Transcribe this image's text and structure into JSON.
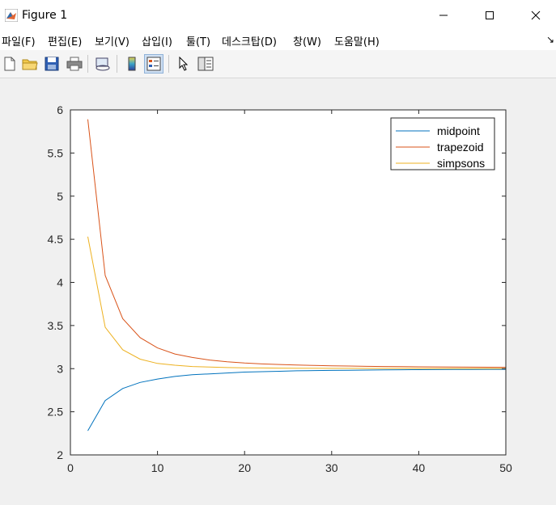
{
  "window": {
    "title": "Figure 1"
  },
  "menu": {
    "items": [
      "파일(F)",
      "편집(E)",
      "보기(V)",
      "삽입(I)",
      "툴(T)",
      "데스크탑(D)",
      "창(W)",
      "도움말(H)"
    ]
  },
  "toolbar": {
    "buttons": [
      "new-figure",
      "open-file",
      "save",
      "print",
      "link-plot",
      "hide-plot-tools",
      "show-plot-tools",
      "edit-plot",
      "open-property-inspector"
    ]
  },
  "chart_data": {
    "type": "line",
    "xlim": [
      0,
      50
    ],
    "ylim": [
      2,
      6
    ],
    "xticks": [
      0,
      10,
      20,
      30,
      40,
      50
    ],
    "yticks": [
      2,
      2.5,
      3,
      3.5,
      4,
      4.5,
      5,
      5.5,
      6
    ],
    "ytick_labels": [
      "2",
      "2.5",
      "3",
      "3.5",
      "4",
      "4.5",
      "5",
      "5.5",
      "6"
    ],
    "grid": false,
    "legend": "top-right",
    "x": [
      2,
      4,
      6,
      8,
      10,
      12,
      14,
      16,
      18,
      20,
      22,
      24,
      26,
      28,
      30,
      32,
      34,
      36,
      38,
      40,
      42,
      44,
      46,
      48,
      50
    ],
    "series": [
      {
        "name": "midpoint",
        "color": "#0072bd",
        "values": [
          2.28,
          2.63,
          2.77,
          2.84,
          2.88,
          2.91,
          2.93,
          2.94,
          2.95,
          2.96,
          2.965,
          2.97,
          2.975,
          2.978,
          2.98,
          2.982,
          2.984,
          2.986,
          2.987,
          2.988,
          2.989,
          2.99,
          2.991,
          2.992,
          2.992
        ]
      },
      {
        "name": "trapezoid",
        "color": "#d95319",
        "values": [
          5.89,
          4.08,
          3.58,
          3.36,
          3.24,
          3.17,
          3.13,
          3.1,
          3.08,
          3.065,
          3.055,
          3.048,
          3.042,
          3.037,
          3.033,
          3.03,
          3.027,
          3.025,
          3.023,
          3.021,
          3.02,
          3.018,
          3.017,
          3.016,
          3.015
        ]
      },
      {
        "name": "simpsons",
        "color": "#edb120",
        "values": [
          4.53,
          3.48,
          3.22,
          3.11,
          3.06,
          3.04,
          3.025,
          3.018,
          3.013,
          3.01,
          3.008,
          3.006,
          3.005,
          3.004,
          3.003,
          3.003,
          3.002,
          3.002,
          3.002,
          3.001,
          3.001,
          3.001,
          3.001,
          3.001,
          3.001
        ]
      }
    ]
  }
}
